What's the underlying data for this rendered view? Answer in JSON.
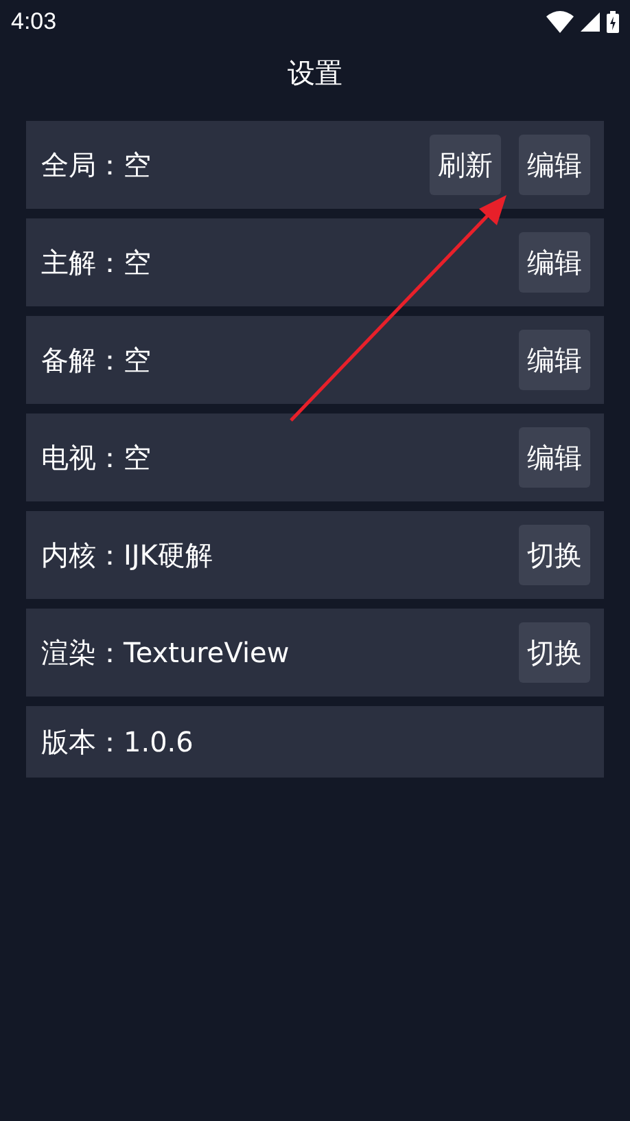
{
  "status_bar": {
    "time": "4:03"
  },
  "title": "设置",
  "rows": [
    {
      "text": "全局：空",
      "buttons": [
        "刷新",
        "编辑"
      ]
    },
    {
      "text": "主解：空",
      "buttons": [
        "编辑"
      ]
    },
    {
      "text": "备解：空",
      "buttons": [
        "编辑"
      ]
    },
    {
      "text": "电视：空",
      "buttons": [
        "编辑"
      ]
    },
    {
      "text": "内核：IJK硬解",
      "buttons": [
        "切换"
      ]
    },
    {
      "text": "渲染：TextureView",
      "buttons": [
        "切换"
      ]
    },
    {
      "text": "版本：1.0.6",
      "buttons": []
    }
  ]
}
